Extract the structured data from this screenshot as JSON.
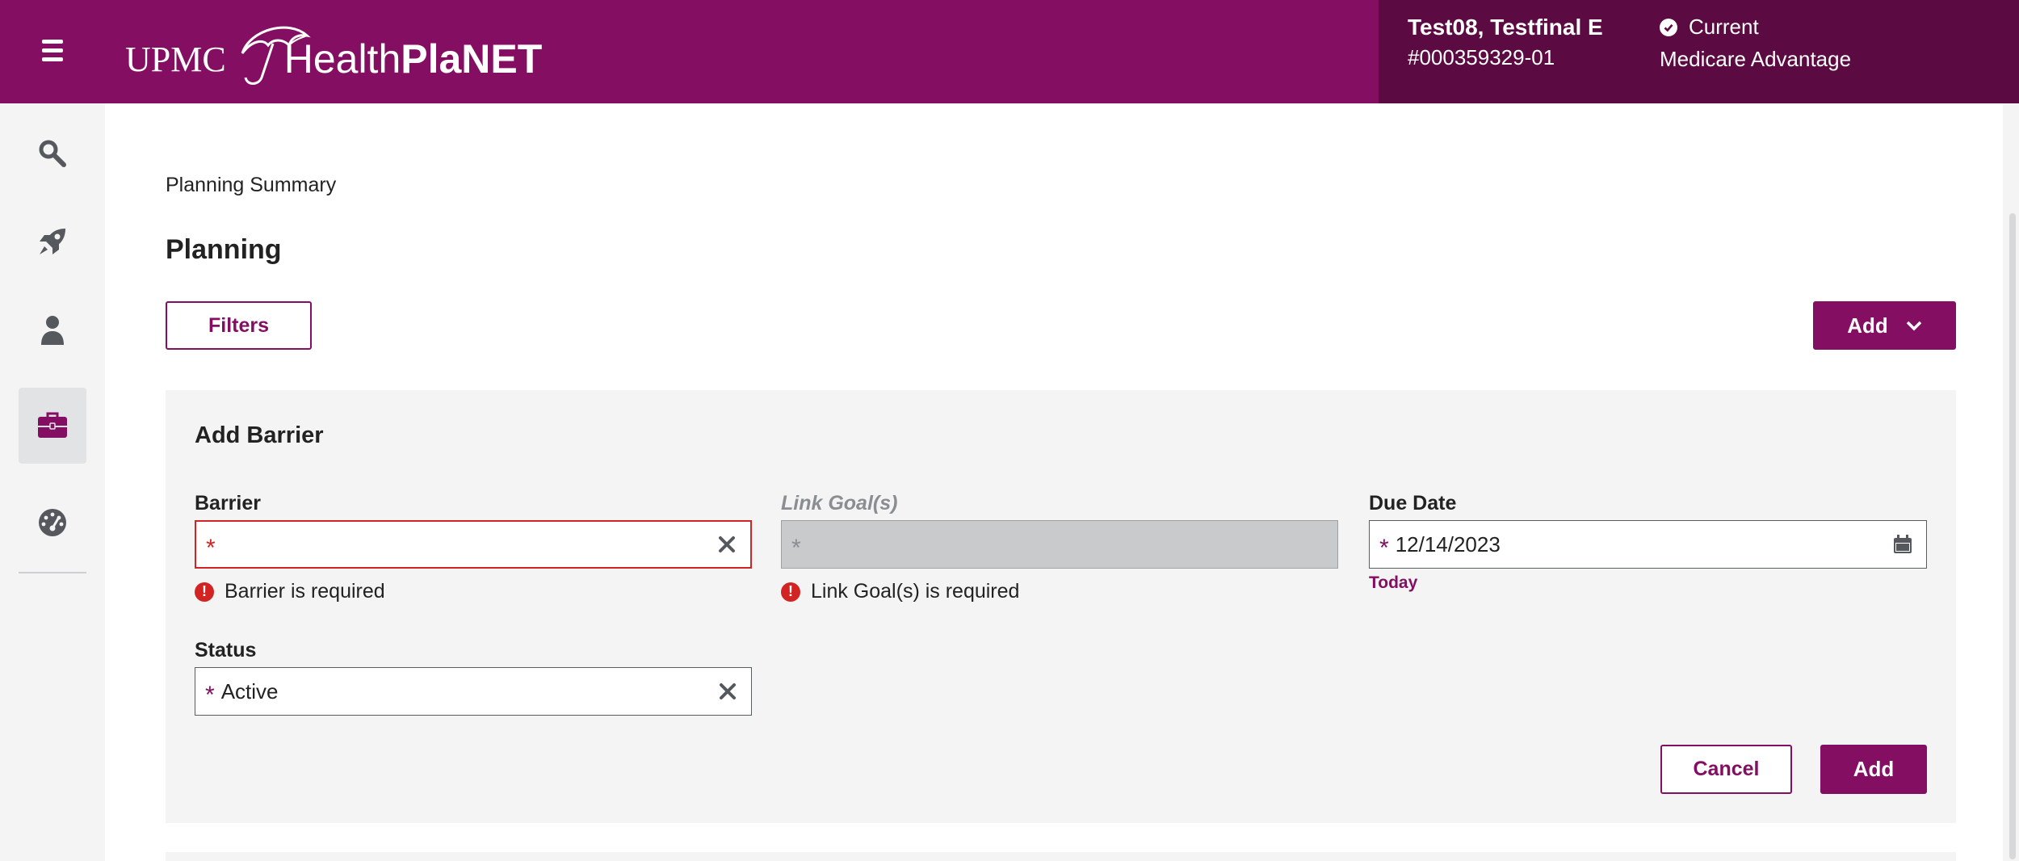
{
  "header": {
    "logo_upmc": "UPMC",
    "logo_health": "Health",
    "logo_planet": "PlaNET",
    "member_name": "Test08, Testfinal E",
    "member_id": "#000359329-01",
    "status": "Current",
    "plan": "Medicare Advantage",
    "colors": {
      "primary": "#840e62",
      "dark": "#5c0a42"
    }
  },
  "sidebar": {
    "items": [
      {
        "icon": "search-icon"
      },
      {
        "icon": "rocket-icon"
      },
      {
        "icon": "person-icon"
      },
      {
        "icon": "briefcase-icon",
        "active": true
      },
      {
        "icon": "dashboard-gauge-icon"
      }
    ]
  },
  "main": {
    "breadcrumb": "Planning Summary",
    "title": "Planning",
    "filters_label": "Filters",
    "add_label": "Add"
  },
  "form": {
    "title": "Add Barrier",
    "barrier": {
      "label": "Barrier",
      "value": "",
      "required": "*",
      "error": "Barrier is required"
    },
    "link_goals": {
      "label": "Link Goal(s)",
      "value": "",
      "required": "*",
      "error": "Link Goal(s) is required"
    },
    "due_date": {
      "label": "Due Date",
      "value": "12/14/2023",
      "required": "*",
      "today_label": "Today"
    },
    "status": {
      "label": "Status",
      "value": "Active",
      "required": "*"
    },
    "cancel_label": "Cancel",
    "submit_label": "Add",
    "error_color": "#d32424"
  }
}
